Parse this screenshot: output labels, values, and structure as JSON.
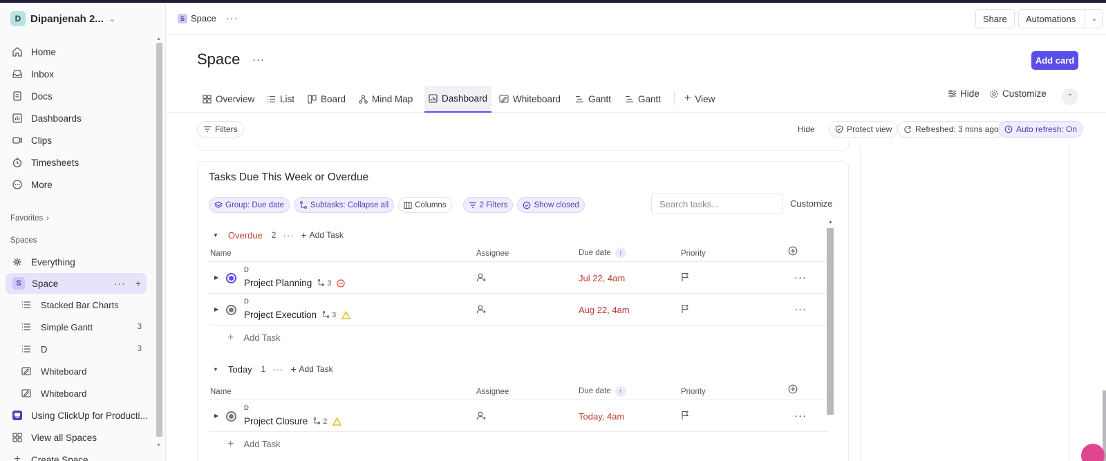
{
  "workspace": {
    "initial": "D",
    "name": "Dipanjenah 2..."
  },
  "sidebar": {
    "nav": [
      {
        "label": "Home",
        "icon": "home-icon"
      },
      {
        "label": "Inbox",
        "icon": "inbox-icon"
      },
      {
        "label": "Docs",
        "icon": "docs-icon"
      },
      {
        "label": "Dashboards",
        "icon": "dashboards-icon"
      },
      {
        "label": "Clips",
        "icon": "clips-icon"
      },
      {
        "label": "Timesheets",
        "icon": "timesheets-icon"
      },
      {
        "label": "More",
        "icon": "more-icon"
      }
    ],
    "favorites_label": "Favorites",
    "spaces_label": "Spaces",
    "everything_label": "Everything",
    "space": {
      "initial": "S",
      "name": "Space"
    },
    "space_items": [
      {
        "label": "Stacked Bar Charts",
        "icon": "list-icon",
        "count": ""
      },
      {
        "label": "Simple Gantt",
        "icon": "list-icon",
        "count": "3"
      },
      {
        "label": "D",
        "icon": "list-icon",
        "count": "3"
      },
      {
        "label": "Whiteboard",
        "icon": "whiteboard-icon",
        "count": ""
      },
      {
        "label": "Whiteboard",
        "icon": "whiteboard-icon",
        "count": ""
      }
    ],
    "using_clickup_label": "Using ClickUp for Producti...",
    "view_all_spaces_label": "View all Spaces",
    "create_space_label": "Create Space"
  },
  "header": {
    "breadcrumb_initial": "S",
    "breadcrumb_label": "Space",
    "share_label": "Share",
    "automations_label": "Automations"
  },
  "page": {
    "title": "Space",
    "add_card_label": "Add card",
    "accent_color": "#5b4de8"
  },
  "tabs": [
    {
      "label": "Overview",
      "icon": "overview-icon"
    },
    {
      "label": "List",
      "icon": "list-icon"
    },
    {
      "label": "Board",
      "icon": "board-icon"
    },
    {
      "label": "Mind Map",
      "icon": "mindmap-icon"
    },
    {
      "label": "Dashboard",
      "icon": "dashboard-icon",
      "active": true
    },
    {
      "label": "Whiteboard",
      "icon": "whiteboard-icon"
    },
    {
      "label": "Gantt",
      "icon": "gantt-icon"
    },
    {
      "label": "Gantt",
      "icon": "gantt-icon"
    }
  ],
  "tabs_right": {
    "view_label": "View",
    "hide_label": "Hide",
    "customize_label": "Customize"
  },
  "filterbar": {
    "filters_label": "Filters",
    "hide_label": "Hide",
    "protect_label": "Protect view",
    "refreshed_label": "Refreshed: 3 mins ago",
    "auto_refresh_label": "Auto refresh: On"
  },
  "card": {
    "title": "Tasks Due This Week or Overdue",
    "chips": {
      "group": "Group: Due date",
      "subtasks": "Subtasks: Collapse all",
      "columns": "Columns",
      "filters": "2 Filters",
      "show_closed": "Show closed"
    },
    "search_placeholder": "Search tasks...",
    "customize_label": "Customize",
    "columns": {
      "name": "Name",
      "assignee": "Assignee",
      "due": "Due date",
      "priority": "Priority"
    },
    "add_task_label": "Add Task",
    "groups": [
      {
        "name": "Overdue",
        "count": "2",
        "color": "#c0392b",
        "tasks": [
          {
            "list": "D",
            "name": "Project Planning",
            "subtasks": "3",
            "priority": "urgent",
            "due": "Jul 22, 4am",
            "status_color": "#5b4de8"
          },
          {
            "list": "D",
            "name": "Project Execution",
            "subtasks": "3",
            "priority": "warning",
            "due": "Aug 22, 4am",
            "status_color": "#777777"
          }
        ]
      },
      {
        "name": "Today",
        "count": "1",
        "color": "#202124",
        "tasks": [
          {
            "list": "D",
            "name": "Project Closure",
            "subtasks": "2",
            "priority": "warning",
            "due": "Today, 4am",
            "status_color": "#777777"
          }
        ]
      }
    ]
  }
}
